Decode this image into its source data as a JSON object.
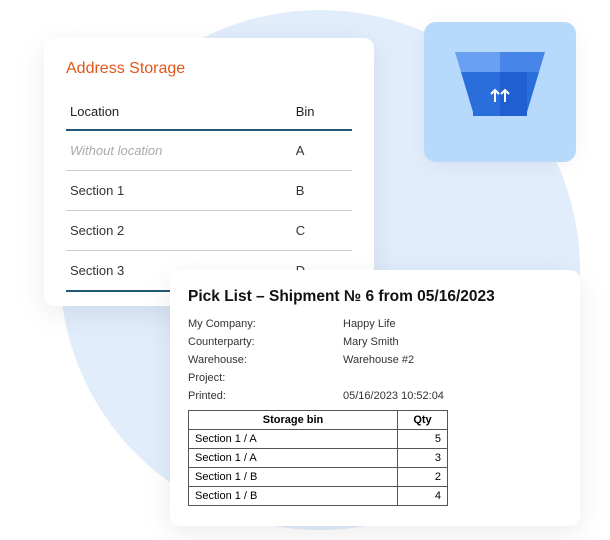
{
  "address_card": {
    "title": "Address Storage",
    "headers": {
      "location": "Location",
      "bin": "Bin"
    },
    "rows": [
      {
        "location": "Without location",
        "bin": "A",
        "without": true
      },
      {
        "location": "Section 1",
        "bin": "B",
        "without": false
      },
      {
        "location": "Section 2",
        "bin": "C",
        "without": false
      },
      {
        "location": "Section 3",
        "bin": "D",
        "without": false
      }
    ]
  },
  "box_tile": {
    "icon": "box-icon"
  },
  "picklist": {
    "title": "Pick List – Shipment № 6 from 05/16/2023",
    "meta": [
      {
        "label": "My Company:",
        "value": "Happy Life"
      },
      {
        "label": "Counterparty:",
        "value": "Mary Smith"
      },
      {
        "label": "Warehouse:",
        "value": "Warehouse #2"
      },
      {
        "label": "Project:",
        "value": ""
      },
      {
        "label": "Printed:",
        "value": "05/16/2023 10:52:04"
      }
    ],
    "table": {
      "headers": {
        "bin": "Storage bin",
        "qty": "Qty"
      },
      "rows": [
        {
          "bin": "Section 1 / A",
          "qty": "5"
        },
        {
          "bin": "Section 1 / A",
          "qty": "3"
        },
        {
          "bin": "Section 1 / B",
          "qty": "2"
        },
        {
          "bin": "Section 1 / B",
          "qty": "4"
        }
      ]
    }
  }
}
